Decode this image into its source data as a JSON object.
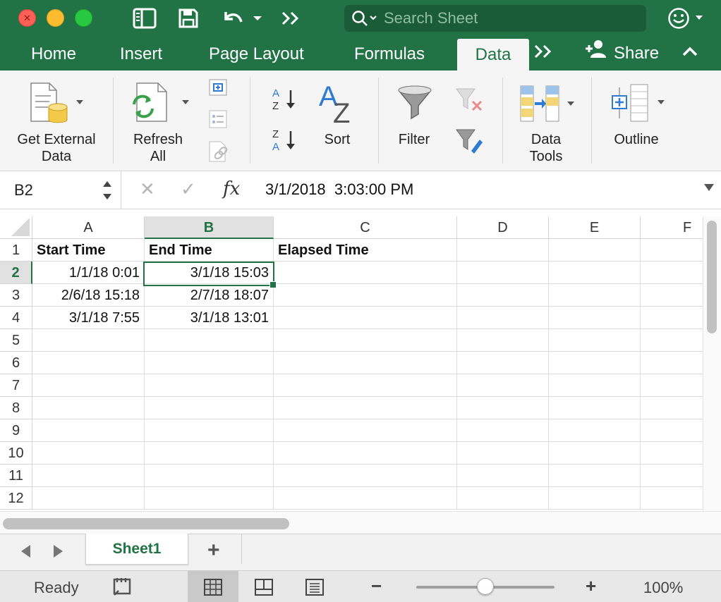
{
  "titlebar": {
    "search_placeholder": "Search Sheet"
  },
  "tabs": [
    {
      "label": "Home"
    },
    {
      "label": "Insert"
    },
    {
      "label": "Page Layout"
    },
    {
      "label": "Formulas"
    },
    {
      "label": "Data",
      "active": true
    }
  ],
  "share_label": "Share",
  "ribbon": {
    "get_external_data": "Get External\nData",
    "get_external_data_l1": "Get External",
    "get_external_data_l2": "Data",
    "refresh_l1": "Refresh",
    "refresh_l2": "All",
    "sort": "Sort",
    "filter": "Filter",
    "data_tools_l1": "Data",
    "data_tools_l2": "Tools",
    "outline": "Outline"
  },
  "formula_bar": {
    "name_box": "B2",
    "fx": "fx",
    "value": "3/1/2018  3:03:00 PM"
  },
  "grid": {
    "columns": [
      "A",
      "B",
      "C",
      "D",
      "E",
      "F"
    ],
    "selected_column": "B",
    "rows": [
      "1",
      "2",
      "3",
      "4",
      "5",
      "6",
      "7",
      "8",
      "9",
      "10",
      "11",
      "12"
    ],
    "selected_row": "2",
    "cells": {
      "A1": "Start Time",
      "B1": "End Time",
      "C1": "Elapsed Time",
      "A2": "1/1/18 0:01",
      "B2": "3/1/18 15:03",
      "A3": "2/6/18 15:18",
      "B3": "2/7/18 18:07",
      "A4": "3/1/18 7:55",
      "B4": "3/1/18 13:01"
    },
    "active_cell": "B2"
  },
  "sheets": [
    {
      "name": "Sheet1",
      "active": true
    }
  ],
  "status": {
    "ready": "Ready",
    "zoom": "100%",
    "zoom_fraction": 0.5
  },
  "colors": {
    "accent": "#217346",
    "titlebar": "#217346"
  }
}
